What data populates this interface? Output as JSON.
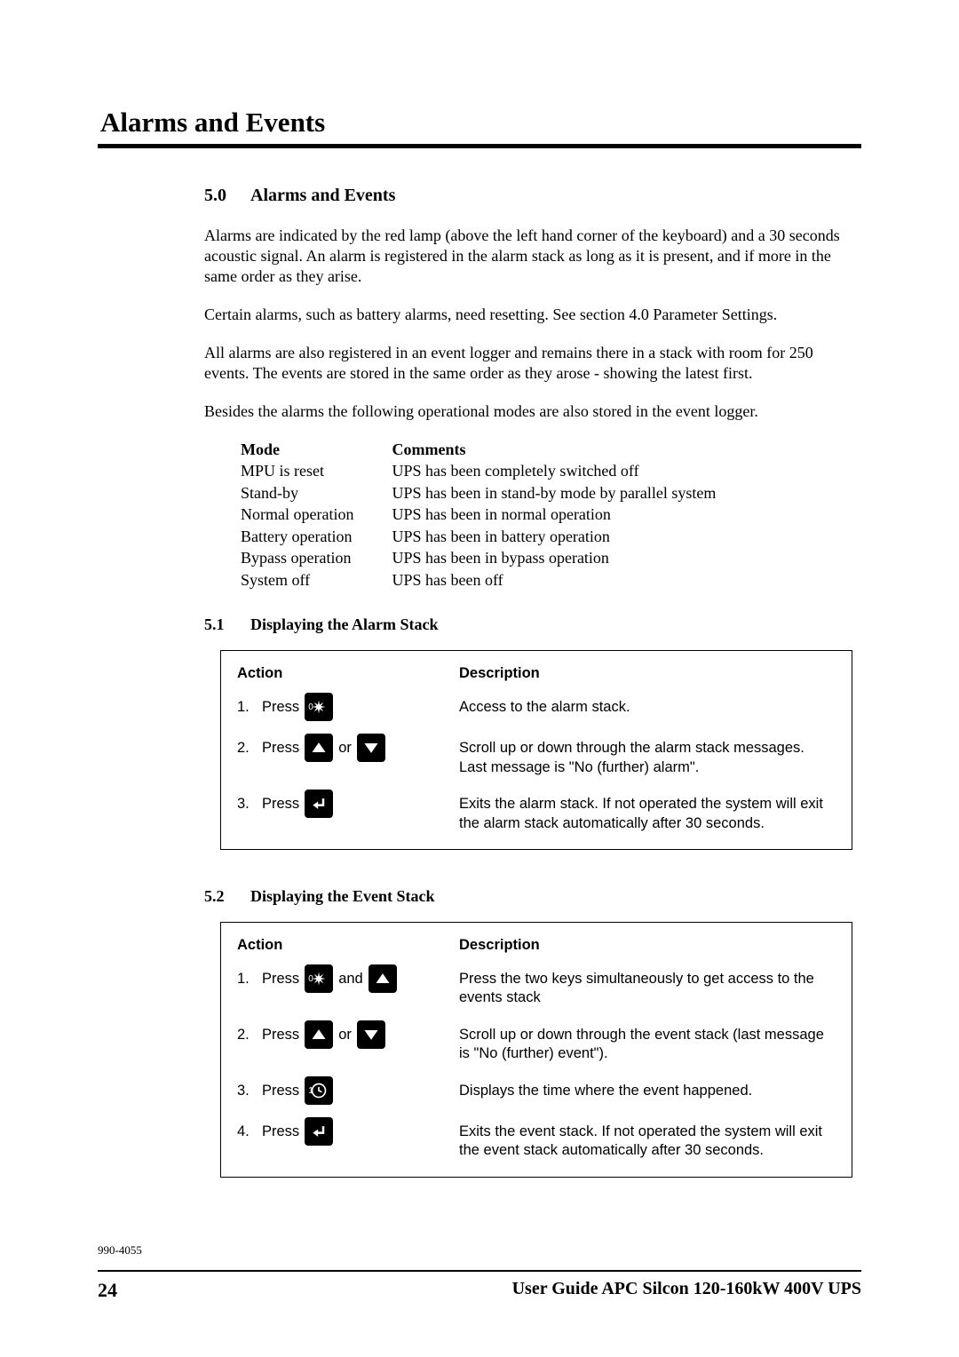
{
  "section_title": "Alarms and Events",
  "heading": {
    "num": "5.0",
    "text": "Alarms and Events"
  },
  "paragraphs": {
    "p1": "Alarms are indicated by the red lamp (above the left hand corner of the keyboard) and a 30 seconds acoustic signal. An alarm is registered in the alarm stack as long as it is present, and if more in the same order as they arise.",
    "p2": "Certain alarms, such as battery alarms, need resetting. See section 4.0 Parameter Settings.",
    "p3": "All alarms are also registered in an event logger and remains there in a stack with room for 250 events. The events are stored in the same order as they arose - showing the latest first.",
    "p4": "Besides the alarms the following operational modes are also stored in the event logger."
  },
  "modes_table": {
    "head_mode": "Mode",
    "head_comments": "Comments",
    "rows": [
      {
        "mode": "MPU is reset",
        "comment": "UPS has been completely switched off"
      },
      {
        "mode": "Stand-by",
        "comment": "UPS has been in stand-by mode by parallel system"
      },
      {
        "mode": "Normal operation",
        "comment": "UPS has been in normal operation"
      },
      {
        "mode": "Battery operation",
        "comment": "UPS has been in battery operation"
      },
      {
        "mode": "Bypass operation",
        "comment": "UPS has been in bypass operation"
      },
      {
        "mode": "System off",
        "comment": "UPS has been off"
      }
    ]
  },
  "sub51": {
    "num": "5.1",
    "text": "Displaying the Alarm Stack"
  },
  "box51": {
    "head_action": "Action",
    "head_desc": "Description",
    "word_press": "Press",
    "word_or": "or",
    "word_and": "and",
    "rows": [
      {
        "num": "1.",
        "keys": [
          {
            "icon": "star",
            "sup": "0"
          }
        ],
        "desc": "Access to the alarm stack."
      },
      {
        "num": "2.",
        "keys": [
          {
            "icon": "up"
          },
          {
            "sep": "or"
          },
          {
            "icon": "down"
          }
        ],
        "desc": "Scroll up or down through the alarm stack messages.\nLast message is \"No (further) alarm\"."
      },
      {
        "num": "3.",
        "keys": [
          {
            "icon": "enter"
          }
        ],
        "desc": "Exits the alarm stack. If not operated the system will exit the alarm stack automatically after 30 seconds."
      }
    ]
  },
  "sub52": {
    "num": "5.2",
    "text": "Displaying the Event Stack"
  },
  "box52": {
    "head_action": "Action",
    "head_desc": "Description",
    "word_press": "Press",
    "word_or": "or",
    "word_and": "and",
    "rows": [
      {
        "num": "1.",
        "keys": [
          {
            "icon": "star",
            "sup": "0"
          },
          {
            "sep": "and"
          },
          {
            "icon": "up"
          }
        ],
        "desc": "Press the two keys simultaneously to get access to the events stack"
      },
      {
        "num": "2.",
        "keys": [
          {
            "icon": "up"
          },
          {
            "sep": "or"
          },
          {
            "icon": "down"
          }
        ],
        "desc": "Scroll up or down through the event stack (last message is \"No (further) event\")."
      },
      {
        "num": "3.",
        "keys": [
          {
            "icon": "clock",
            "sup": "1"
          }
        ],
        "desc": "Displays the time where the event happened."
      },
      {
        "num": "4.",
        "keys": [
          {
            "icon": "enter"
          }
        ],
        "desc": "Exits the event stack. If not operated the system will exit the event stack automatically after 30 seconds."
      }
    ]
  },
  "docnum": "990-4055",
  "footer": {
    "page": "24",
    "title": "User Guide APC Silcon 120-160kW 400V UPS"
  }
}
